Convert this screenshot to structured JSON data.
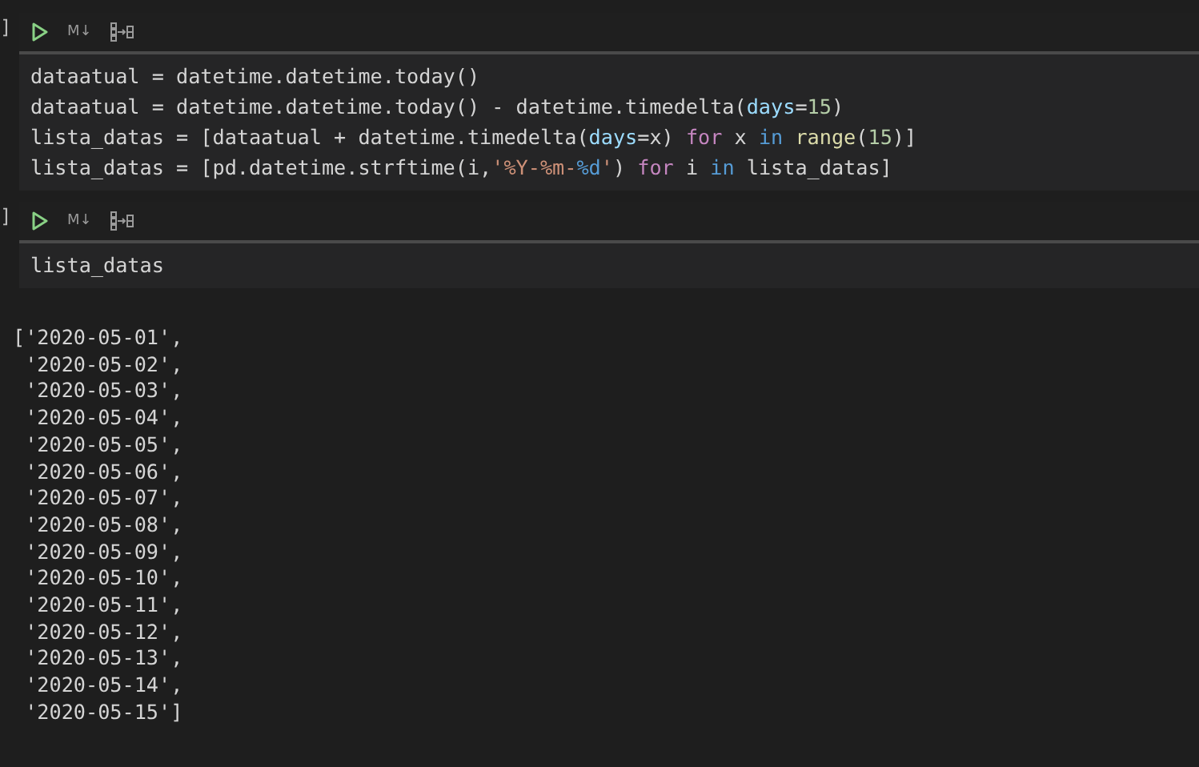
{
  "cells": [
    {
      "bracket": "]",
      "markdown_label": "M↓",
      "code_lines": [
        [
          {
            "text": "dataatual = datetime.datetime.today()",
            "kind": "plain"
          }
        ],
        [
          {
            "text": "dataatual = datetime.datetime.today() - datetime.timedelta(",
            "kind": "plain"
          },
          {
            "text": "days",
            "kind": "param"
          },
          {
            "text": "=",
            "kind": "plain"
          },
          {
            "text": "15",
            "kind": "number"
          },
          {
            "text": ")",
            "kind": "plain"
          }
        ],
        [
          {
            "text": "lista_datas = [dataatual + datetime.timedelta(",
            "kind": "plain"
          },
          {
            "text": "days",
            "kind": "param"
          },
          {
            "text": "=x) ",
            "kind": "plain"
          },
          {
            "text": "for",
            "kind": "control"
          },
          {
            "text": " x ",
            "kind": "plain"
          },
          {
            "text": "in",
            "kind": "operator"
          },
          {
            "text": " range",
            "kind": "function"
          },
          {
            "text": "(",
            "kind": "plain"
          },
          {
            "text": "15",
            "kind": "number"
          },
          {
            "text": ")]",
            "kind": "plain"
          }
        ],
        [
          {
            "text": "lista_datas = [pd.datetime.strftime(i,",
            "kind": "plain"
          },
          {
            "text": "'%Y-%m-",
            "kind": "string"
          },
          {
            "text": "%d",
            "kind": "escape"
          },
          {
            "text": "'",
            "kind": "string"
          },
          {
            "text": ") ",
            "kind": "plain"
          },
          {
            "text": "for",
            "kind": "control"
          },
          {
            "text": " i ",
            "kind": "plain"
          },
          {
            "text": "in",
            "kind": "operator"
          },
          {
            "text": " lista_datas]",
            "kind": "plain"
          }
        ]
      ]
    },
    {
      "bracket": "]",
      "markdown_label": "M↓",
      "code_lines": [
        [
          {
            "text": "lista_datas",
            "kind": "plain"
          }
        ]
      ]
    }
  ],
  "output_lines": [
    "['2020-05-01',",
    " '2020-05-02',",
    " '2020-05-03',",
    " '2020-05-04',",
    " '2020-05-05',",
    " '2020-05-06',",
    " '2020-05-07',",
    " '2020-05-08',",
    " '2020-05-09',",
    " '2020-05-10',",
    " '2020-05-11',",
    " '2020-05-12',",
    " '2020-05-13',",
    " '2020-05-14',",
    " '2020-05-15']"
  ]
}
